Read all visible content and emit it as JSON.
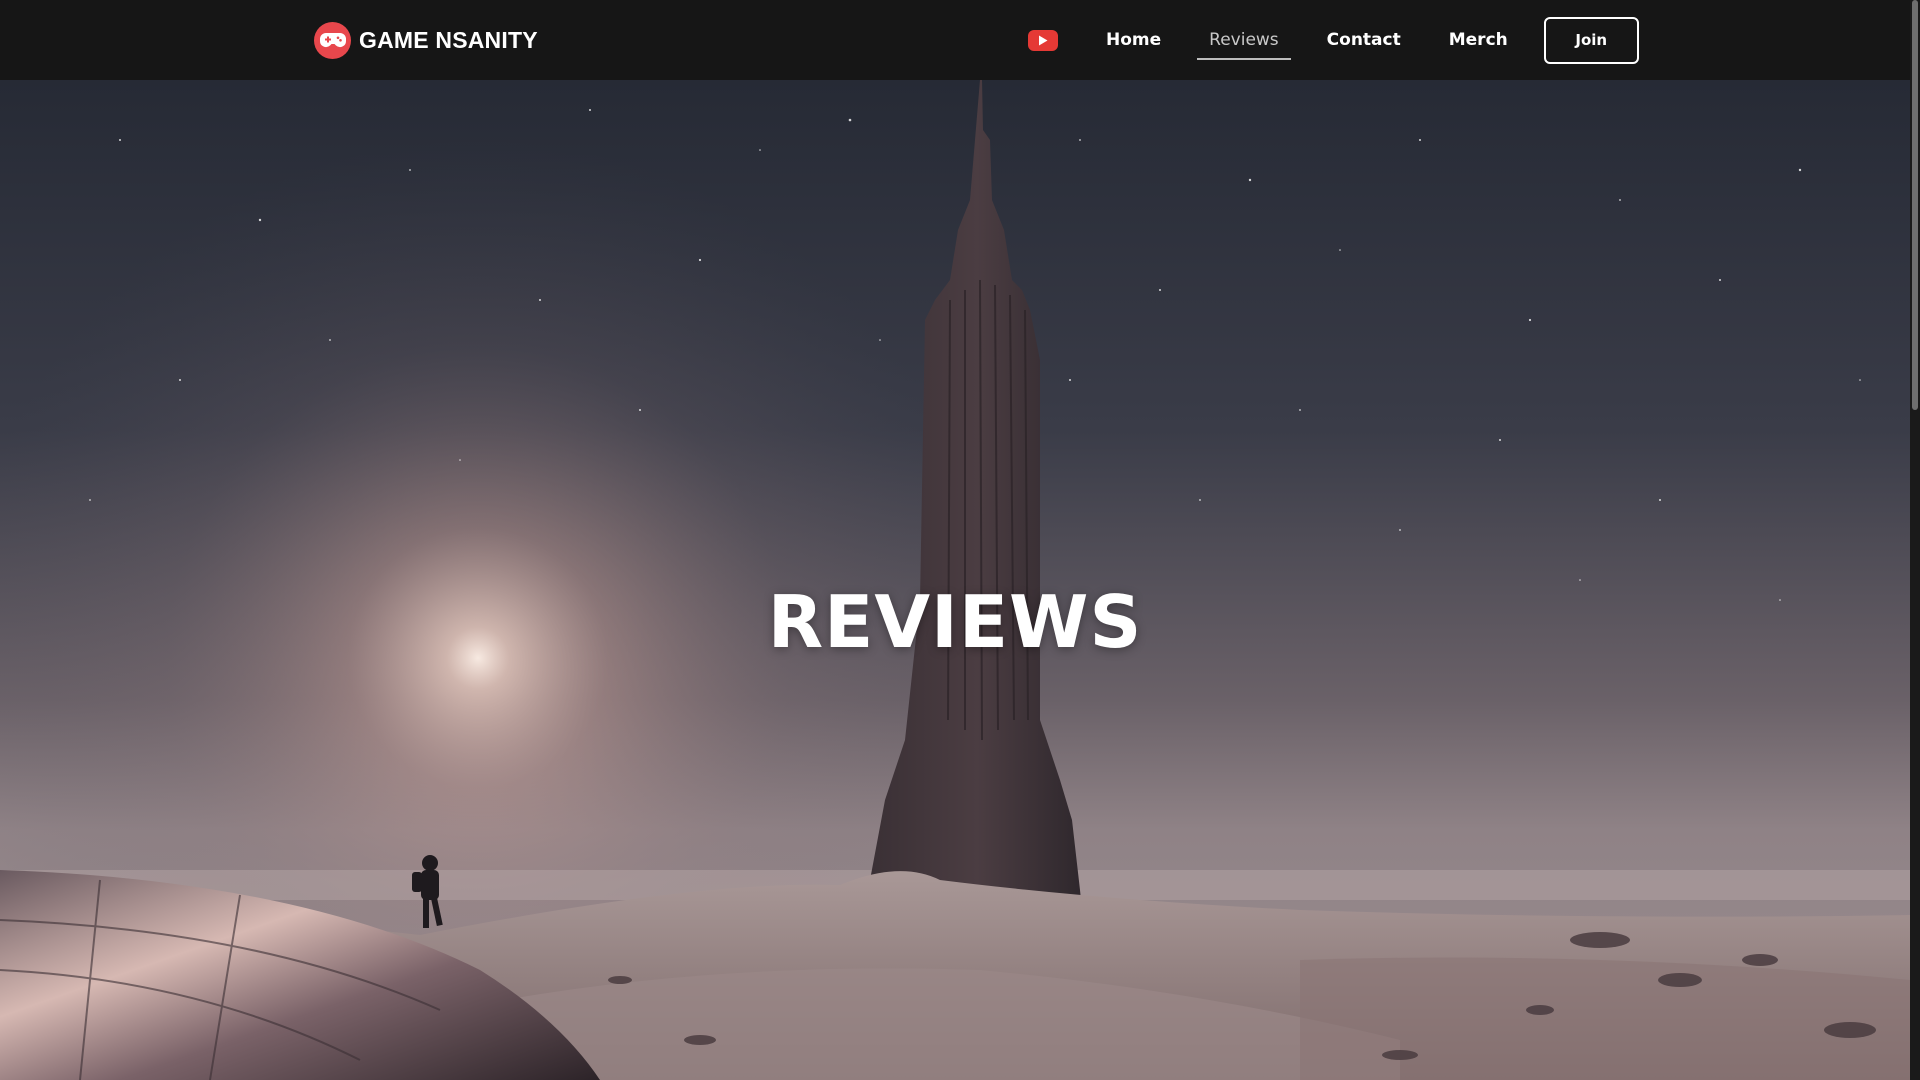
{
  "brand": {
    "name": "GAME NSANITY",
    "accent_color": "#e8474c",
    "logo_icon": "gamepad-icon"
  },
  "nav": {
    "youtube_icon": "youtube-icon",
    "links": [
      {
        "label": "Home",
        "active": false
      },
      {
        "label": "Reviews",
        "active": true
      },
      {
        "label": "Contact",
        "active": false
      },
      {
        "label": "Merch",
        "active": false
      }
    ],
    "join_label": "Join"
  },
  "hero": {
    "title": "REVIEWS"
  },
  "colors": {
    "navbar_bg": "#161616",
    "youtube_red": "#e53935",
    "text": "#ffffff"
  }
}
